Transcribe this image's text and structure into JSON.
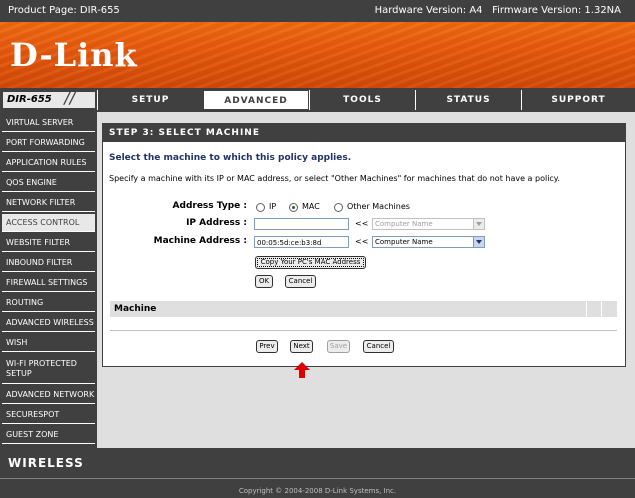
{
  "topbar": {
    "product_page": "Product Page: DIR-655",
    "versions": "Hardware Version: A4   Firmware Version: 1.32NA"
  },
  "brand": {
    "logo": "D-Link",
    "model": "DIR-655"
  },
  "tabs": [
    {
      "label": "SETUP"
    },
    {
      "label": "ADVANCED"
    },
    {
      "label": "TOOLS"
    },
    {
      "label": "STATUS"
    },
    {
      "label": "SUPPORT"
    }
  ],
  "sidebar": {
    "items": [
      {
        "label": "VIRTUAL SERVER"
      },
      {
        "label": "PORT FORWARDING"
      },
      {
        "label": "APPLICATION RULES"
      },
      {
        "label": "QOS ENGINE"
      },
      {
        "label": "NETWORK FILTER"
      },
      {
        "label": "ACCESS CONTROL"
      },
      {
        "label": "WEBSITE FILTER"
      },
      {
        "label": "INBOUND FILTER"
      },
      {
        "label": "FIREWALL SETTINGS"
      },
      {
        "label": "ROUTING"
      },
      {
        "label": "ADVANCED WIRELESS"
      },
      {
        "label": "WISH"
      },
      {
        "label": "WI-FI PROTECTED SETUP"
      },
      {
        "label": "ADVANCED NETWORK"
      },
      {
        "label": "SECURESPOT"
      },
      {
        "label": "GUEST ZONE"
      }
    ]
  },
  "footer_brand": "WIRELESS",
  "footer_copyright": "Copyright © 2004-2008 D-Link Systems, Inc.",
  "panel": {
    "heading": "STEP 3: SELECT MACHINE",
    "subtitle": "Select the machine to which this policy applies.",
    "description": "Specify a machine with its IP or MAC address, or select \"Other Machines\" for machines that do not have a policy.",
    "address_type_label": "Address Type :",
    "address_types": [
      "IP",
      "MAC",
      "Other Machines"
    ],
    "selected_address_type": "MAC",
    "ip_label": "IP Address :",
    "ip_value": "",
    "machine_label": "Machine Address :",
    "machine_value": "00:05:5d:ce:b3:8d",
    "ltlt": "<<",
    "computer_name": "Computer Name",
    "copy_mac_label": "Copy Your PC's MAC Address",
    "ok_label": "OK",
    "cancel_label": "Cancel",
    "table_header": "Machine"
  },
  "nav_buttons": {
    "prev": "Prev",
    "next": "Next",
    "save": "Save",
    "cancel": "Cancel"
  },
  "colors": {
    "dark_gray": "#404040",
    "orange": "#e8590c",
    "accent_blue": "#223366",
    "arrow_red": "#e00000"
  }
}
